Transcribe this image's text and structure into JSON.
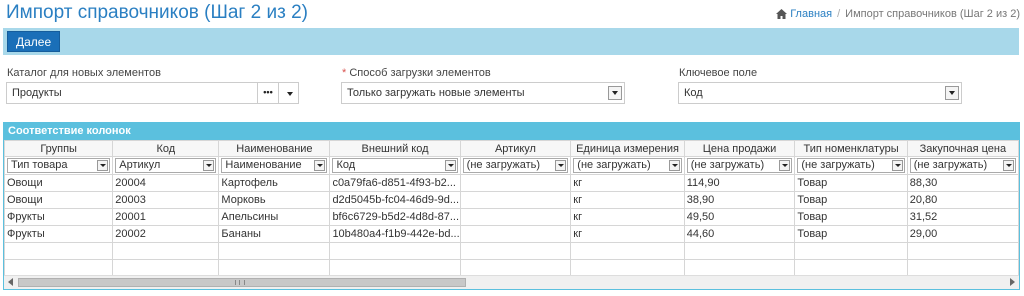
{
  "page": {
    "title": "Импорт справочников (Шаг 2 из 2)"
  },
  "breadcrumb": {
    "home_label": "Главная",
    "current_label": "Импорт справочников (Шаг 2 из 2)"
  },
  "toolbar": {
    "next_label": "Далее"
  },
  "fields": {
    "catalog": {
      "label": "Каталог для новых элементов",
      "value": "Продукты",
      "more_label": "•••"
    },
    "load_mode": {
      "required_mark": "*",
      "label": "Способ загрузки элементов",
      "value": "Только загружать новые элементы"
    },
    "key_field": {
      "label": "Ключевое поле",
      "value": "Код"
    }
  },
  "panel": {
    "title": "Соответствие колонок"
  },
  "columns": [
    {
      "header": "Группы",
      "mapping": "Тип товара"
    },
    {
      "header": "Код",
      "mapping": "Артикул"
    },
    {
      "header": "Наименование",
      "mapping": "Наименование"
    },
    {
      "header": "Внешний код",
      "mapping": "Код"
    },
    {
      "header": "Артикул",
      "mapping": "(не загружать)"
    },
    {
      "header": "Единица измерения",
      "mapping": "(не загружать)"
    },
    {
      "header": "Цена продажи",
      "mapping": "(не загружать)"
    },
    {
      "header": "Тип номенклатуры",
      "mapping": "(не загружать)"
    },
    {
      "header": "Закупочная цена",
      "mapping": "(не загружать)"
    }
  ],
  "rows": [
    [
      "Овощи",
      "20004",
      "Картофель",
      "c0a79fa6-d851-4f93-b2...",
      "",
      "кг",
      "114,90",
      "Товар",
      "88,30"
    ],
    [
      "Овощи",
      "20003",
      "Морковь",
      "d2d5045b-fc04-46d9-9d...",
      "",
      "кг",
      "38,90",
      "Товар",
      "20,80"
    ],
    [
      "Фрукты",
      "20001",
      "Апельсины",
      "bf6c6729-b5d2-4d8d-87...",
      "",
      "кг",
      "49,50",
      "Товар",
      "31,52"
    ],
    [
      "Фрукты",
      "20002",
      "Бананы",
      "10b480a4-f1b9-442e-bd...",
      "",
      "кг",
      "44,60",
      "Товар",
      "29,00"
    ]
  ],
  "colors": {
    "accent": "#2a7fc2",
    "toolbar_bg": "#a8d8ea",
    "button_bg": "#1a6fb8",
    "panel_head": "#5bc0de",
    "required": "#d9534f"
  },
  "icons": {
    "home": "home-icon",
    "dropdown": "caret-down-icon"
  }
}
